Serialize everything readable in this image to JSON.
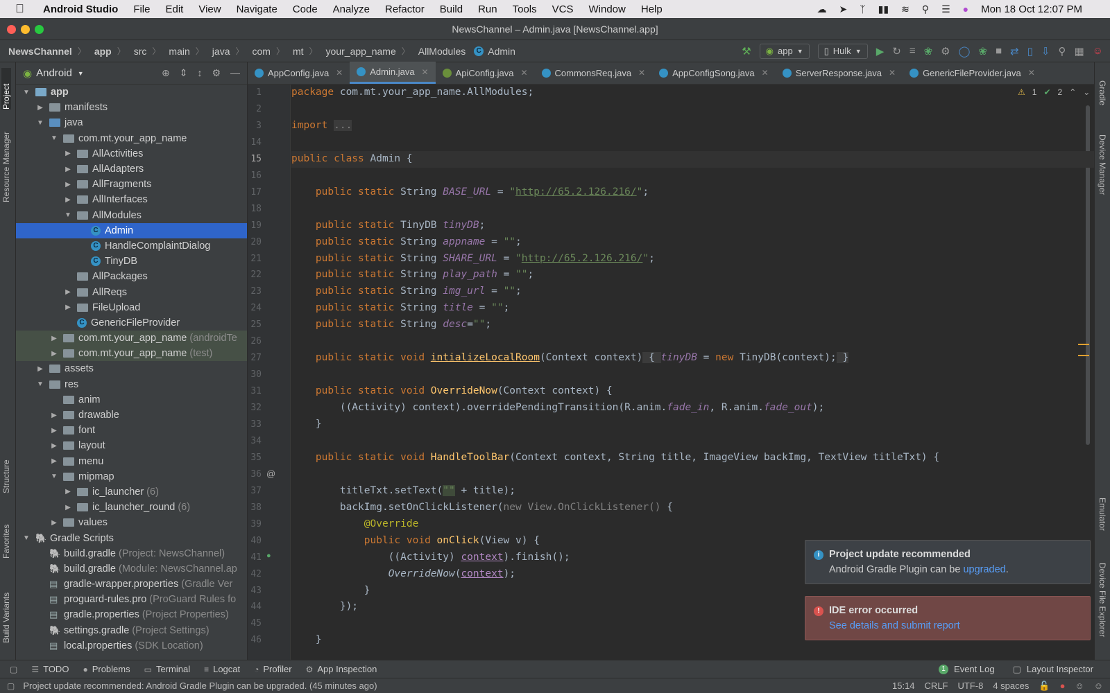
{
  "menubar": {
    "app_name": "Android Studio",
    "items": [
      "File",
      "Edit",
      "View",
      "Navigate",
      "Code",
      "Analyze",
      "Refactor",
      "Build",
      "Run",
      "Tools",
      "VCS",
      "Window",
      "Help"
    ],
    "datetime": "Mon 18 Oct  12:07 PM"
  },
  "window": {
    "title": "NewsChannel – Admin.java [NewsChannel.app]"
  },
  "breadcrumbs": [
    "NewsChannel",
    "app",
    "src",
    "main",
    "java",
    "com",
    "mt",
    "your_app_name",
    "AllModules",
    "Admin"
  ],
  "toolbar": {
    "run_config": "app",
    "device": "Hulk"
  },
  "side_tools": {
    "left": [
      "Project",
      "Resource Manager",
      "Structure",
      "Favorites",
      "Build Variants"
    ],
    "right": [
      "Gradle",
      "Device Manager",
      "Emulator",
      "Device File Explorer"
    ]
  },
  "project_panel": {
    "view_label": "Android",
    "tree": [
      {
        "label": "app",
        "note": "",
        "depth": 0,
        "open": true,
        "type": "module"
      },
      {
        "label": "manifests",
        "note": "",
        "depth": 1,
        "open": false,
        "type": "folder"
      },
      {
        "label": "java",
        "note": "",
        "depth": 1,
        "open": true,
        "type": "folder-blue"
      },
      {
        "label": "com.mt.your_app_name",
        "note": "",
        "depth": 2,
        "open": true,
        "type": "package"
      },
      {
        "label": "AllActivities",
        "note": "",
        "depth": 3,
        "open": false,
        "type": "package"
      },
      {
        "label": "AllAdapters",
        "note": "",
        "depth": 3,
        "open": false,
        "type": "package"
      },
      {
        "label": "AllFragments",
        "note": "",
        "depth": 3,
        "open": false,
        "type": "package"
      },
      {
        "label": "AllInterfaces",
        "note": "",
        "depth": 3,
        "open": false,
        "type": "package"
      },
      {
        "label": "AllModules",
        "note": "",
        "depth": 3,
        "open": true,
        "type": "package"
      },
      {
        "label": "Admin",
        "note": "",
        "depth": 4,
        "open": null,
        "type": "class",
        "selected": true
      },
      {
        "label": "HandleComplaintDialog",
        "note": "",
        "depth": 4,
        "open": null,
        "type": "class"
      },
      {
        "label": "TinyDB",
        "note": "",
        "depth": 4,
        "open": null,
        "type": "class"
      },
      {
        "label": "AllPackages",
        "note": "",
        "depth": 3,
        "open": null,
        "type": "package"
      },
      {
        "label": "AllReqs",
        "note": "",
        "depth": 3,
        "open": false,
        "type": "package"
      },
      {
        "label": "FileUpload",
        "note": "",
        "depth": 3,
        "open": false,
        "type": "package"
      },
      {
        "label": "GenericFileProvider",
        "note": "",
        "depth": 3,
        "open": null,
        "type": "class"
      },
      {
        "label": "com.mt.your_app_name",
        "note": "(androidTe",
        "depth": 2,
        "open": false,
        "type": "package",
        "highlight": true
      },
      {
        "label": "com.mt.your_app_name",
        "note": "(test)",
        "depth": 2,
        "open": false,
        "type": "package",
        "highlight": true
      },
      {
        "label": "assets",
        "note": "",
        "depth": 1,
        "open": false,
        "type": "folder"
      },
      {
        "label": "res",
        "note": "",
        "depth": 1,
        "open": true,
        "type": "folder"
      },
      {
        "label": "anim",
        "note": "",
        "depth": 2,
        "open": null,
        "type": "folder"
      },
      {
        "label": "drawable",
        "note": "",
        "depth": 2,
        "open": false,
        "type": "folder"
      },
      {
        "label": "font",
        "note": "",
        "depth": 2,
        "open": false,
        "type": "folder"
      },
      {
        "label": "layout",
        "note": "",
        "depth": 2,
        "open": false,
        "type": "folder"
      },
      {
        "label": "menu",
        "note": "",
        "depth": 2,
        "open": false,
        "type": "folder"
      },
      {
        "label": "mipmap",
        "note": "",
        "depth": 2,
        "open": true,
        "type": "folder"
      },
      {
        "label": "ic_launcher",
        "note": "(6)",
        "depth": 3,
        "open": false,
        "type": "folder"
      },
      {
        "label": "ic_launcher_round",
        "note": "(6)",
        "depth": 3,
        "open": false,
        "type": "folder"
      },
      {
        "label": "values",
        "note": "",
        "depth": 2,
        "open": false,
        "type": "folder"
      },
      {
        "label": "Gradle Scripts",
        "note": "",
        "depth": 0,
        "open": true,
        "type": "gradle"
      },
      {
        "label": "build.gradle",
        "note": "(Project: NewsChannel)",
        "depth": 1,
        "open": null,
        "type": "gradle"
      },
      {
        "label": "build.gradle",
        "note": "(Module: NewsChannel.ap",
        "depth": 1,
        "open": null,
        "type": "gradle"
      },
      {
        "label": "gradle-wrapper.properties",
        "note": "(Gradle Ver",
        "depth": 1,
        "open": null,
        "type": "props"
      },
      {
        "label": "proguard-rules.pro",
        "note": "(ProGuard Rules fo",
        "depth": 1,
        "open": null,
        "type": "props"
      },
      {
        "label": "gradle.properties",
        "note": "(Project Properties)",
        "depth": 1,
        "open": null,
        "type": "props"
      },
      {
        "label": "settings.gradle",
        "note": "(Project Settings)",
        "depth": 1,
        "open": null,
        "type": "gradle"
      },
      {
        "label": "local.properties",
        "note": "(SDK Location)",
        "depth": 1,
        "open": null,
        "type": "props"
      }
    ]
  },
  "tabs": [
    {
      "label": "AppConfig.java",
      "icon": "class",
      "active": false
    },
    {
      "label": "Admin.java",
      "icon": "class",
      "active": true
    },
    {
      "label": "ApiConfig.java",
      "icon": "interface",
      "active": false
    },
    {
      "label": "CommonsReq.java",
      "icon": "class",
      "active": false
    },
    {
      "label": "AppConfigSong.java",
      "icon": "class",
      "active": false
    },
    {
      "label": "ServerResponse.java",
      "icon": "class",
      "active": false
    },
    {
      "label": "GenericFileProvider.java",
      "icon": "class",
      "active": false
    }
  ],
  "inspections": {
    "warnings": "1",
    "weak_warnings": "2"
  },
  "code_lines": [
    {
      "n": "1",
      "html": "<span class='kw'>package</span> com.mt.your_app_name.AllModules;"
    },
    {
      "n": "2",
      "html": ""
    },
    {
      "n": "3",
      "html": "<span class='kw'>import</span> <span class='gray' style='background:#3b3b3b'>...</span>"
    },
    {
      "n": "14",
      "html": ""
    },
    {
      "n": "15",
      "html": "<span class='kw'>public class</span> Admin {"
    },
    {
      "n": "16",
      "html": ""
    },
    {
      "n": "17",
      "html": "    <span class='kw'>public static</span> String <span class='fld'>BASE_URL</span> = <span class='str'>\"<span class='url' style='color:#6a8759'>http://65.2.126.216/</span>\"</span>;"
    },
    {
      "n": "18",
      "html": ""
    },
    {
      "n": "19",
      "html": "    <span class='kw'>public static</span> TinyDB <span class='fld'>tinyDB</span>;"
    },
    {
      "n": "20",
      "html": "    <span class='kw'>public static</span> String <span class='fld'>appname</span> = <span class='str'>\"\"</span>;"
    },
    {
      "n": "21",
      "html": "    <span class='kw'>public static</span> String <span class='fld'>SHARE_URL</span> = <span class='str'>\"<span class='url' style='color:#6a8759'>http://65.2.126.216/</span>\"</span>;"
    },
    {
      "n": "22",
      "html": "    <span class='kw'>public static</span> String <span class='fld'>play_path</span> = <span class='str'>\"\"</span>;"
    },
    {
      "n": "23",
      "html": "    <span class='kw'>public static</span> String <span class='fld'>img_url</span> = <span class='str'>\"\"</span>;"
    },
    {
      "n": "24",
      "html": "    <span class='kw'>public static</span> String <span class='fld'>title</span> = <span class='str'>\"\"</span>;"
    },
    {
      "n": "25",
      "html": "    <span class='kw'>public static</span> String <span class='fld'>desc</span>=<span class='str'>\"\"</span>;"
    },
    {
      "n": "26",
      "html": ""
    },
    {
      "n": "27",
      "html": "    <span class='kw'>public static void</span> <span class='fn' style='text-decoration:underline'>intializeLocalRoom</span>(Context context)<span style='background:#3b3b3b'> { </span><span class='fld'>tinyDB</span> = <span class='kw'>new</span> TinyDB(context);<span style='background:#3b3b3b'> }</span>"
    },
    {
      "n": "30",
      "html": ""
    },
    {
      "n": "31",
      "html": "    <span class='kw'>public static void</span> <span class='fn'>OverrideNow</span>(Context context) {"
    },
    {
      "n": "32",
      "html": "        ((Activity) context).overridePendingTransition(R.anim.<span class='fld'>fade_in</span>, R.anim.<span class='fld'>fade_out</span>);"
    },
    {
      "n": "33",
      "html": "    }"
    },
    {
      "n": "34",
      "html": ""
    },
    {
      "n": "35",
      "html": "    <span class='kw'>public static void</span> <span class='fn'>HandleToolBar</span>(Context context, String title, ImageView backImg, TextView titleTxt) {"
    },
    {
      "n": "36",
      "html": ""
    },
    {
      "n": "37",
      "html": "        titleTxt.setText(<span class='str' style='background:#3f4b3a'>\"\"</span> + title);"
    },
    {
      "n": "38",
      "html": "        backImg.setOnClickListener(<span class='gray'>new View.OnClickListener()</span> {"
    },
    {
      "n": "39",
      "html": "            <span class='ann'>@Override</span>"
    },
    {
      "n": "40",
      "html": "            <span class='kw'>public void</span> <span class='fn'>onClick</span>(View v) {"
    },
    {
      "n": "41",
      "html": "                ((Activity) <span style='color:#b389c5;text-decoration:underline'>context</span>).finish();"
    },
    {
      "n": "42",
      "html": "                <span style='font-style:italic'>OverrideNow</span>(<span style='color:#b389c5;text-decoration:underline'>context</span>);"
    },
    {
      "n": "43",
      "html": "            }"
    },
    {
      "n": "44",
      "html": "        });"
    },
    {
      "n": "45",
      "html": ""
    },
    {
      "n": "46",
      "html": "    }"
    }
  ],
  "notifications": [
    {
      "title": "Project update recommended",
      "body": "Android Gradle Plugin can be ",
      "link": "upgraded",
      "tail": ".",
      "kind": "info"
    },
    {
      "title": "IDE error occurred",
      "body": "",
      "link": "See details and submit report",
      "tail": "",
      "kind": "error"
    }
  ],
  "bottom_tools": [
    "TODO",
    "Problems",
    "Terminal",
    "Logcat",
    "Profiler",
    "App Inspection"
  ],
  "bottom_right": {
    "event_log": "Event Log",
    "event_count": "1",
    "layout_inspector": "Layout Inspector"
  },
  "status": {
    "message": "Project update recommended: Android Gradle Plugin can be upgraded. (45 minutes ago)",
    "position": "15:14",
    "line_sep": "CRLF",
    "encoding": "UTF-8",
    "indent": "4 spaces"
  },
  "colors": {
    "accent": "#2f65ca",
    "keyword": "#cc7832",
    "string": "#6a8759",
    "field": "#9876aa",
    "function": "#ffc66d",
    "link": "#589df6",
    "error_bg": "#704745",
    "info_bg": "#3d4146"
  }
}
